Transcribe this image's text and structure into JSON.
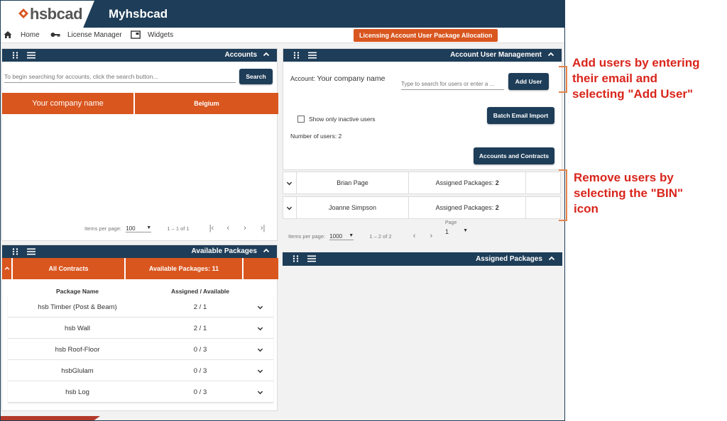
{
  "header": {
    "logo_text": "hsbcad",
    "app_title": "Myhsbcad"
  },
  "nav": {
    "items": [
      {
        "label": "Home",
        "icon": "home-icon"
      },
      {
        "label": "License Manager",
        "icon": "key-icon"
      },
      {
        "label": "Widgets",
        "icon": "widget-icon"
      }
    ],
    "active_page": "Licensing Account User Package Allocation"
  },
  "colors": {
    "navy": "#1e3d58",
    "orange": "#d9561f",
    "annotation_red": "#d9251b",
    "bracket_orange": "#e6834a"
  },
  "accounts": {
    "title": "Accounts",
    "search_placeholder": "To begin searching for accounts, click the search button...",
    "search_button": "Search",
    "row": {
      "company": "Your company name",
      "country": "Belgium"
    },
    "pager": {
      "items_per_page_label": "Items per page:",
      "items_per_page": "100",
      "range": "1 – 1 of 1"
    }
  },
  "account_users": {
    "title": "Account User Management",
    "account_label": "Account:",
    "account_name": "Your company name",
    "user_search_placeholder": "Type to search for users or enter a ...",
    "add_user_button": "Add User",
    "batch_import_button": "Batch Email Import",
    "inactive_checkbox_label": "Show only inactive users",
    "inactive_checked": false,
    "number_of_users_label": "Number of users: 2",
    "accounts_contracts_button": "Accounts and Contracts",
    "users": [
      {
        "name": "Brian Page",
        "assigned_label": "Assigned Packages:",
        "assigned_count": "2"
      },
      {
        "name": "Joanne Simpson",
        "assigned_label": "Assigned Packages:",
        "assigned_count": "2"
      }
    ],
    "pager": {
      "items_per_page_label": "Items per page:",
      "items_per_page": "1000",
      "range": "1 – 2 of 2",
      "page_label": "Page",
      "page": "1"
    }
  },
  "available_packages": {
    "title": "Available Packages",
    "contracts_cell": "All Contracts",
    "available_label": "Available Packages:",
    "available_count": "11",
    "col_name": "Package Name",
    "col_assigned": "Assigned / Available",
    "packages": [
      {
        "name": "hsb Timber (Post & Beam)",
        "value": "2 / 1"
      },
      {
        "name": "hsb Wall",
        "value": "2 / 1"
      },
      {
        "name": "hsb Roof-Floor",
        "value": "0 / 3"
      },
      {
        "name": "hsbGlulam",
        "value": "0 / 3"
      },
      {
        "name": "hsb Log",
        "value": "0 / 3"
      }
    ]
  },
  "assigned_packages": {
    "title": "Assigned Packages"
  },
  "annotations": {
    "add_users": [
      "Add users by entering",
      "their email and",
      "selecting \"Add User\""
    ],
    "remove_users": [
      "Remove users by",
      "selecting the \"BIN\"",
      "icon"
    ]
  }
}
